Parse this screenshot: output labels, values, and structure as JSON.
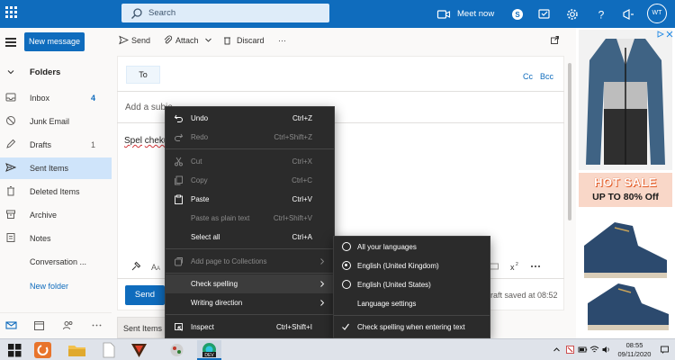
{
  "topbar": {
    "search_placeholder": "Search",
    "meet_now": "Meet now",
    "avatar_initials": "WT",
    "icons": [
      "waffle-icon",
      "search-icon",
      "video-icon",
      "skype-icon",
      "feedback-icon",
      "gear-icon",
      "help-icon",
      "megaphone-icon"
    ]
  },
  "leftnav": {
    "new_message": "New message",
    "folders_label": "Folders",
    "items": [
      {
        "label": "Inbox",
        "count": "4",
        "icon": "inbox-icon"
      },
      {
        "label": "Junk Email",
        "count": "",
        "icon": "junk-icon"
      },
      {
        "label": "Drafts",
        "count": "1",
        "icon": "drafts-icon"
      },
      {
        "label": "Sent Items",
        "count": "",
        "icon": "sent-icon",
        "selected": true
      },
      {
        "label": "Deleted Items",
        "count": "",
        "icon": "trash-icon"
      },
      {
        "label": "Archive",
        "count": "",
        "icon": "archive-icon"
      },
      {
        "label": "Notes",
        "count": "",
        "icon": "notes-icon"
      },
      {
        "label": "Conversation ...",
        "count": "",
        "icon": ""
      }
    ],
    "new_folder": "New folder"
  },
  "compose": {
    "send_cmd": "Send",
    "attach_cmd": "Attach",
    "discard_cmd": "Discard",
    "more_cmd": "···",
    "to_label": "To",
    "cc": "Cc",
    "bcc": "Bcc",
    "subject_placeholder": "Add a subje",
    "body_word1": "Spel",
    "body_word2": "cheku",
    "send_button": "Send",
    "draft_status": "raft saved at 08:52",
    "sent_tab": "Sent Items"
  },
  "ad": {
    "hot_sale": "HOT SALE",
    "promo": "UP TO 80% Off"
  },
  "context_menu": {
    "items": [
      {
        "label": "Undo",
        "shortcut": "Ctrl+Z",
        "disabled": false,
        "icon": "undo-icon"
      },
      {
        "label": "Redo",
        "shortcut": "Ctrl+Shift+Z",
        "disabled": true,
        "icon": "redo-icon"
      },
      {
        "label": "Cut",
        "shortcut": "Ctrl+X",
        "disabled": true,
        "icon": "cut-icon"
      },
      {
        "label": "Copy",
        "shortcut": "Ctrl+C",
        "disabled": true,
        "icon": "copy-icon"
      },
      {
        "label": "Paste",
        "shortcut": "Ctrl+V",
        "disabled": false,
        "icon": "paste-icon"
      },
      {
        "label": "Paste as plain text",
        "shortcut": "Ctrl+Shift+V",
        "disabled": true,
        "icon": ""
      },
      {
        "label": "Select all",
        "shortcut": "Ctrl+A",
        "disabled": false,
        "icon": ""
      },
      {
        "label": "Add page to Collections",
        "shortcut": "",
        "disabled": true,
        "icon": "collections-icon",
        "submenu": true
      },
      {
        "label": "Check spelling",
        "shortcut": "",
        "disabled": false,
        "icon": "",
        "submenu": true,
        "highlighted": true
      },
      {
        "label": "Writing direction",
        "shortcut": "",
        "disabled": false,
        "icon": "",
        "submenu": true
      },
      {
        "label": "Inspect",
        "shortcut": "Ctrl+Shift+I",
        "disabled": false,
        "icon": "inspect-icon"
      }
    ]
  },
  "spelling_submenu": {
    "items": [
      {
        "label": "All your languages",
        "type": "radio",
        "checked": false
      },
      {
        "label": "English (United Kingdom)",
        "type": "radio",
        "checked": true
      },
      {
        "label": "English (United States)",
        "type": "radio",
        "checked": false
      },
      {
        "label": "Language settings",
        "type": "plain",
        "checked": false
      },
      {
        "label": "Check spelling when entering text",
        "type": "check",
        "checked": true
      }
    ]
  },
  "taskbar": {
    "time": "08:55",
    "date": "09/11/2020",
    "dev_badge": "DEV"
  },
  "colors": {
    "accent": "#0f6cbd",
    "menu_bg": "#2b2b2b",
    "selected_folder": "#cfe4fa"
  }
}
